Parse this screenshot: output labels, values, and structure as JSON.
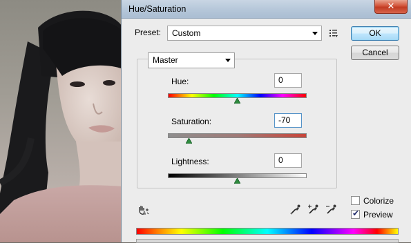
{
  "dialog": {
    "title": "Hue/Saturation",
    "close_label": "✕"
  },
  "preset": {
    "label": "Preset:",
    "value": "Custom"
  },
  "buttons": {
    "ok": "OK",
    "cancel": "Cancel"
  },
  "channel": {
    "value": "Master"
  },
  "sliders": {
    "hue": {
      "label": "Hue:",
      "value": "0",
      "level": 0.5
    },
    "saturation": {
      "label": "Saturation:",
      "value": "-70",
      "level": 0.15
    },
    "lightness": {
      "label": "Lightness:",
      "value": "0",
      "level": 0.5
    }
  },
  "options": {
    "colorize": {
      "label": "Colorize",
      "checked": false
    },
    "preview": {
      "label": "Preview",
      "checked": true
    }
  },
  "icons": {
    "preset_menu": "preset-options-icon",
    "targeted_adjust": "hand-adjust-icon",
    "eyedropper": "eyedropper-icon",
    "eyedropper_add": "eyedropper-plus-icon",
    "eyedropper_subtract": "eyedropper-minus-icon"
  }
}
